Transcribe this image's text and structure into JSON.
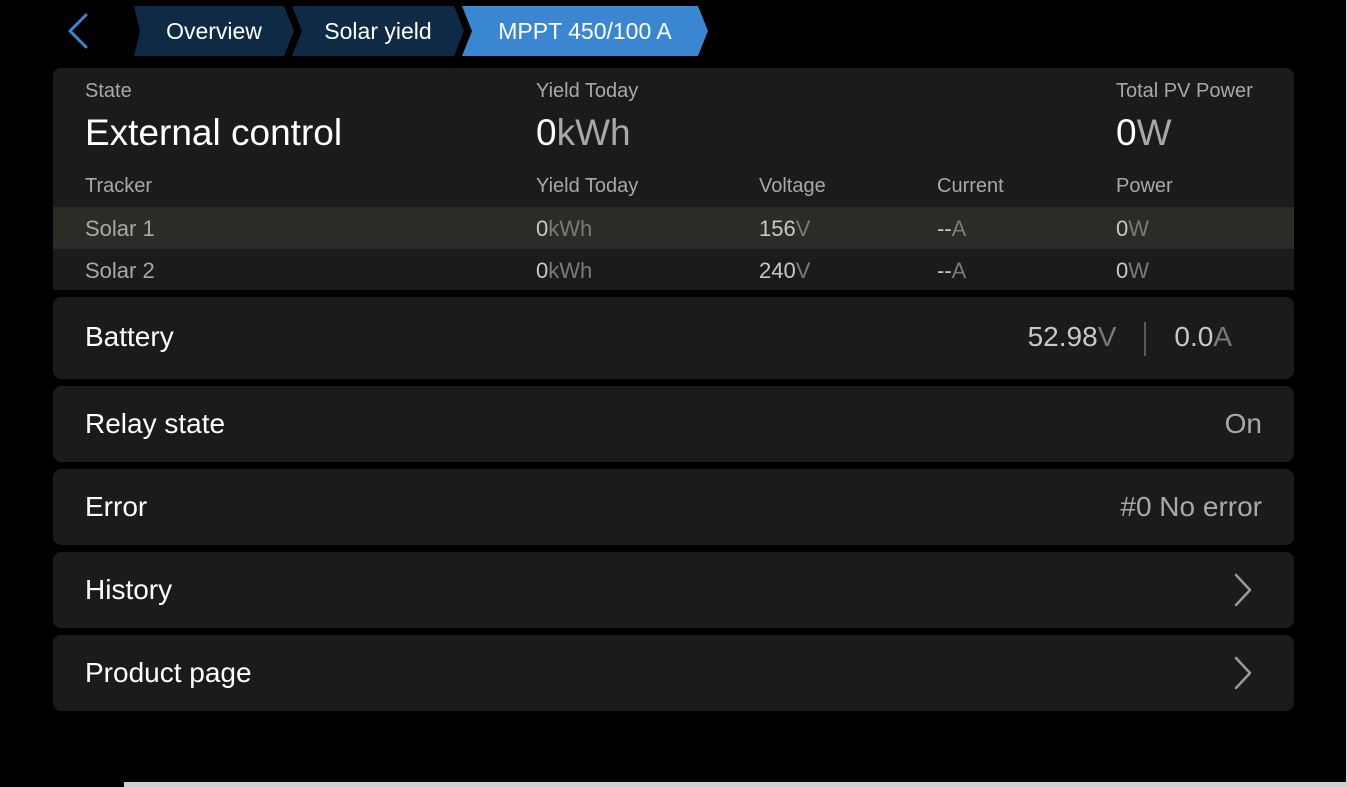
{
  "breadcrumbs": [
    {
      "label": "Overview"
    },
    {
      "label": "Solar yield"
    },
    {
      "label": "MPPT 450/100 A"
    }
  ],
  "summary": {
    "state_label": "State",
    "state_value": "External control",
    "yield_label": "Yield Today",
    "yield_value": "0",
    "yield_unit": "kWh",
    "pv_power_label": "Total PV Power",
    "pv_power_value": "0",
    "pv_power_unit": "W"
  },
  "trackers": {
    "headers": {
      "tracker": "Tracker",
      "yield": "Yield Today",
      "voltage": "Voltage",
      "current": "Current",
      "power": "Power"
    },
    "rows": [
      {
        "name": "Solar 1",
        "yield": "0",
        "yield_unit": "kWh",
        "voltage": "156",
        "voltage_unit": "V",
        "current": "--",
        "current_unit": "A",
        "power": "0",
        "power_unit": "W"
      },
      {
        "name": "Solar 2",
        "yield": "0",
        "yield_unit": "kWh",
        "voltage": "240",
        "voltage_unit": "V",
        "current": "--",
        "current_unit": "A",
        "power": "0",
        "power_unit": "W"
      }
    ]
  },
  "battery": {
    "label": "Battery",
    "voltage": "52.98",
    "voltage_unit": "V",
    "current": "0.0",
    "current_unit": "A"
  },
  "relay": {
    "label": "Relay state",
    "value": "On"
  },
  "error": {
    "label": "Error",
    "value": "#0 No error"
  },
  "history": {
    "label": "History"
  },
  "product_page": {
    "label": "Product page"
  },
  "colors": {
    "accent": "#3a86d0",
    "crumb_bg": "#0f2a44",
    "card_bg": "#1b1b1b"
  }
}
